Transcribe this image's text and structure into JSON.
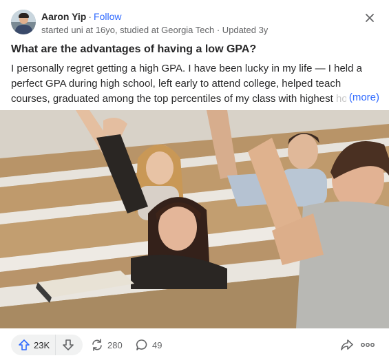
{
  "author": {
    "name": "Aaron Yip",
    "separator": "·",
    "follow_label": "Follow",
    "credential": "started uni at 16yo, studied at Georgia Tech · Updated 3y"
  },
  "question": {
    "title": "What are the advantages of having a low GPA?"
  },
  "answer": {
    "text": "I personally regret getting a high GPA. I have been lucky in my life — I held a perfect GPA during high school, left early to attend college, helped teach courses, graduated among the top percentiles of my class with highest",
    "faded_text": "ho",
    "more_label": "(more)"
  },
  "image": {
    "subject": "students raising hands in lecture hall"
  },
  "actions": {
    "upvotes": "23K",
    "shares": "280",
    "comments": "49"
  },
  "colors": {
    "accent": "#2e69ff",
    "text": "#282829",
    "secondary": "#636466"
  },
  "icons": [
    "close-icon",
    "upvote-icon",
    "downvote-icon",
    "reshare-icon",
    "comment-icon",
    "share-icon",
    "more-icon"
  ]
}
